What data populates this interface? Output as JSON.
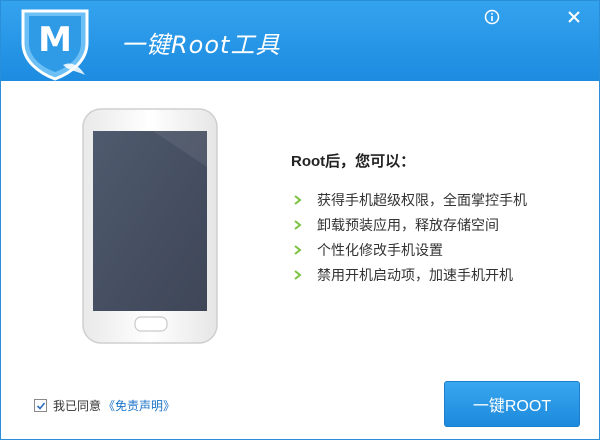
{
  "window": {
    "title": "一键Root工具"
  },
  "titlebar": {
    "info_icon": "info-circle-icon",
    "close_icon": "close-icon",
    "accent_color": "#2196e8"
  },
  "features": {
    "heading": "Root后，您可以：",
    "items": [
      "获得手机超级权限，全面掌控手机",
      "卸载预装应用，释放存储空间",
      "个性化修改手机设置",
      "禁用开机启动项，加速手机开机"
    ],
    "bullet_icon": "chevron-right-icon",
    "bullet_color": "#7cc242"
  },
  "agreement": {
    "checked": true,
    "label": "我已同意",
    "link_text": "《免责声明》"
  },
  "actions": {
    "root_button_label": "一键ROOT"
  }
}
